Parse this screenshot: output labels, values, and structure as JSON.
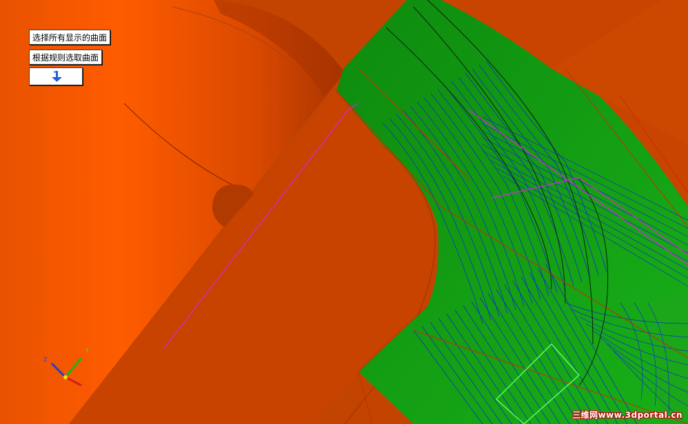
{
  "toolbar": {
    "select_all_label": "选择所有显示的曲面",
    "select_rule_label": "根据规则选取曲面",
    "confirm_icon": "arrow-down-return-icon"
  },
  "axes": {
    "x_label": "X",
    "y_label": "Y",
    "z_label": "Z"
  },
  "watermark": {
    "text": "三维网www.3dportal.cn"
  },
  "colors": {
    "part_orange": "#d84a00",
    "part_highlight": "#ff5a00",
    "selected_surface_green": "#16a016",
    "toolpath_blue": "#1030c8",
    "boundary_magenta": "#e020e0",
    "edge_red": "#c02000"
  }
}
